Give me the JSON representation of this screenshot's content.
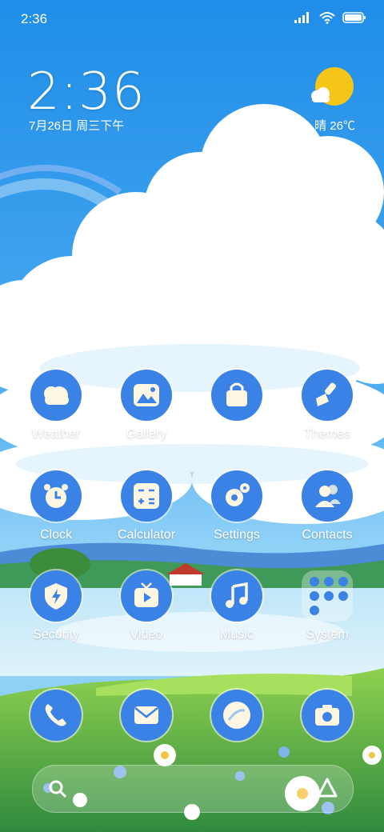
{
  "status_bar": {
    "time": "2:36"
  },
  "clock_widget": {
    "time": "2:36",
    "date": "7月26日 周三下午"
  },
  "weather_widget": {
    "text": "晴 26℃"
  },
  "apps": {
    "weather": "Weather",
    "gallery": "Gallery",
    "themes": "Themes",
    "clock": "Clock",
    "calculator": "Calculator",
    "settings": "Settings",
    "contacts": "Contacts",
    "security": "Security",
    "video": "Video",
    "music": "Music",
    "system": "System"
  },
  "colors": {
    "icon_bg": "#3b82e6",
    "icon_fg": "#fdf6e3",
    "sky_top": "#1e88e5"
  }
}
